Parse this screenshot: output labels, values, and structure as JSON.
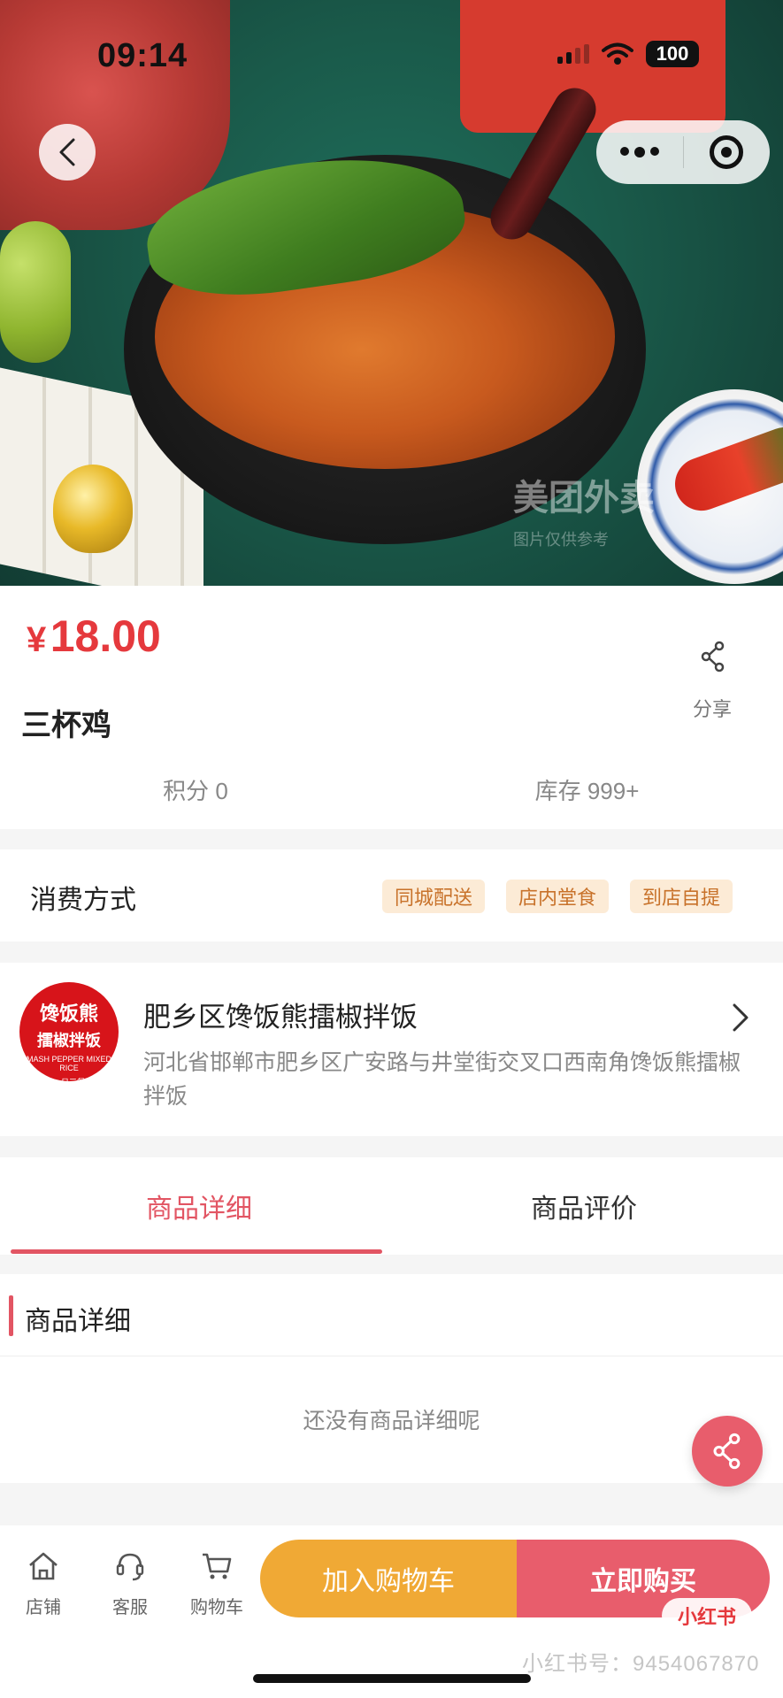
{
  "status_bar": {
    "time": "09:14",
    "battery": "100"
  },
  "hero": {
    "watermark": "美团外卖",
    "watermark_sub": "图片仅供参考"
  },
  "product": {
    "currency": "¥",
    "price": "18.00",
    "name": "三杯鸡",
    "share_label": "分享",
    "points": "积分 0",
    "stock": "库存 999+"
  },
  "consumption": {
    "label": "消费方式",
    "tags": [
      "同城配送",
      "店内堂食",
      "到店自提"
    ]
  },
  "shop": {
    "logo_line1": "馋饭熊",
    "logo_line2": "擂椒拌饭",
    "logo_line3": "MASH PEPPER MIXED RICE",
    "logo_line4": "一日三餐",
    "name": "肥乡区馋饭熊擂椒拌饭",
    "address": "河北省邯郸市肥乡区广安路与井堂街交叉口西南角馋饭熊擂椒拌饭"
  },
  "tabs": [
    {
      "label": "商品详细",
      "active": true
    },
    {
      "label": "商品评价",
      "active": false
    }
  ],
  "detail": {
    "title": "商品详细",
    "empty_text": "还没有商品详细呢"
  },
  "bottom_nav": {
    "store": "店铺",
    "service": "客服",
    "cart": "购物车",
    "add_to_cart": "加入购物车",
    "buy_now": "立即购买"
  },
  "overlay": {
    "xhs_badge": "小红书",
    "xhs_id": "小红书号：9454067870"
  },
  "colors": {
    "accent": "#e25563",
    "price": "#e5393d",
    "cart_button": "#f0a935",
    "buy_button": "#e85d6c",
    "tag_bg": "#fcebd6",
    "tag_text": "#c8722a"
  }
}
